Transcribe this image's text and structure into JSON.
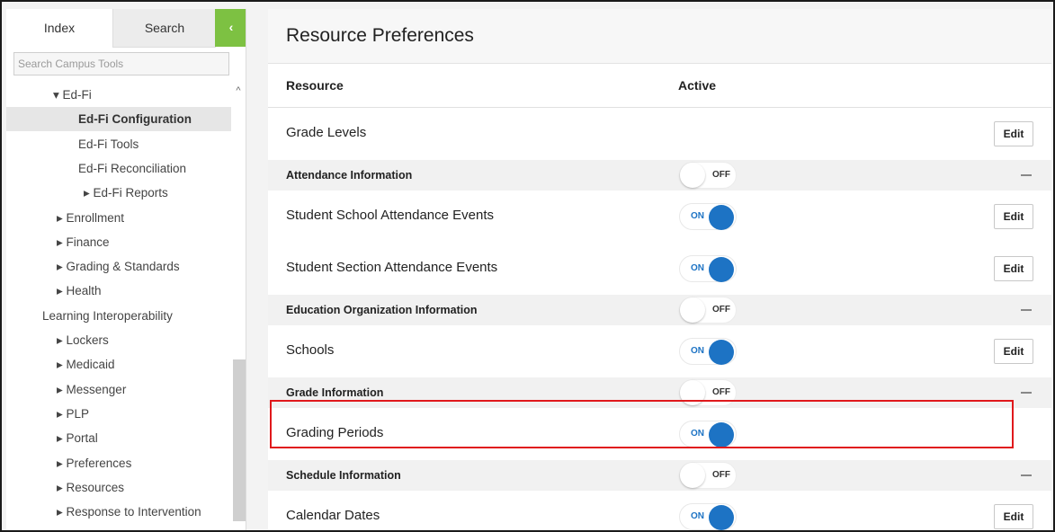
{
  "sidebar": {
    "tabs": {
      "index": "Index",
      "search": "Search",
      "collapse": "‹"
    },
    "search_placeholder": "Search Campus Tools",
    "tree": [
      {
        "label": "▾ Ed-Fi"
      },
      {
        "label": "Ed-Fi Configuration",
        "selected": true
      },
      {
        "label": "Ed-Fi Tools"
      },
      {
        "label": "Ed-Fi Reconciliation"
      },
      {
        "label": "▸ Ed-Fi Reports"
      },
      {
        "label": "▸ Enrollment"
      },
      {
        "label": "▸ Finance"
      },
      {
        "label": "▸ Grading & Standards"
      },
      {
        "label": "▸ Health"
      },
      {
        "label": "Learning Interoperability"
      },
      {
        "label": "▸ Lockers"
      },
      {
        "label": "▸ Medicaid"
      },
      {
        "label": "▸ Messenger"
      },
      {
        "label": "▸ PLP"
      },
      {
        "label": "▸ Portal"
      },
      {
        "label": "▸ Preferences"
      },
      {
        "label": "▸ Resources"
      },
      {
        "label": "▸ Response to Intervention"
      }
    ],
    "scroll_up": "^"
  },
  "main": {
    "title": "Resource Preferences",
    "header": {
      "resource": "Resource",
      "active": "Active"
    },
    "edit_label": "Edit",
    "toggle_on": "ON",
    "toggle_off": "OFF",
    "rows": [
      {
        "type": "item",
        "label": "Grade Levels",
        "toggle": null,
        "edit": true
      },
      {
        "type": "group",
        "label": "Attendance Information",
        "toggle": "off"
      },
      {
        "type": "item",
        "label": "Student School Attendance Events",
        "toggle": "on",
        "edit": true
      },
      {
        "type": "item",
        "label": "Student Section Attendance Events",
        "toggle": "on",
        "edit": true
      },
      {
        "type": "group",
        "label": "Education Organization Information",
        "toggle": "off"
      },
      {
        "type": "item",
        "label": "Schools",
        "toggle": "on",
        "edit": true
      },
      {
        "type": "group",
        "label": "Grade Information",
        "toggle": "off"
      },
      {
        "type": "item",
        "label": "Grading Periods",
        "toggle": "on",
        "edit": false
      },
      {
        "type": "group",
        "label": "Schedule Information",
        "toggle": "off"
      },
      {
        "type": "item",
        "label": "Calendar Dates",
        "toggle": "on",
        "edit": true
      }
    ]
  },
  "colors": {
    "accent_green": "#7dc142",
    "toggle_blue": "#1d73c4",
    "highlight_red": "#e0191c"
  }
}
